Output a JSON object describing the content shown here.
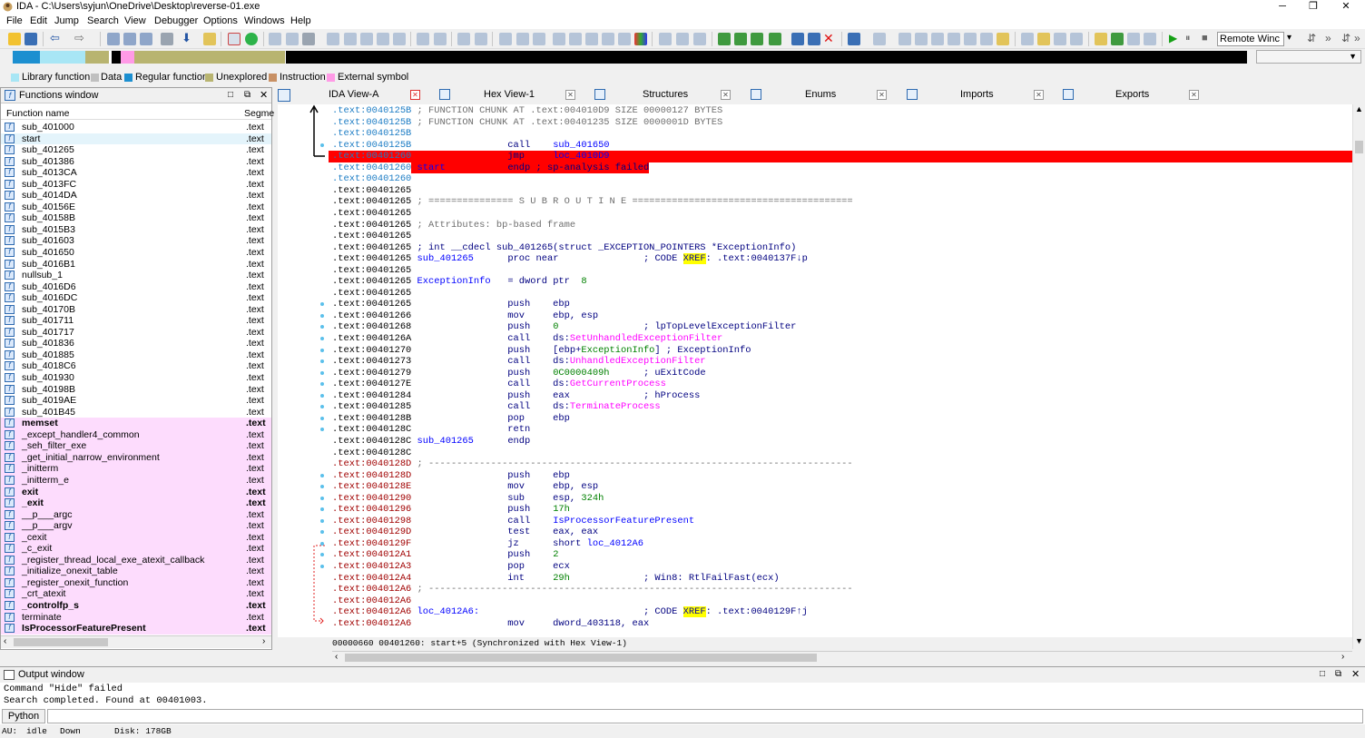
{
  "window": {
    "title": "IDA - C:\\Users\\syjun\\OneDrive\\Desktop\\reverse-01.exe",
    "minimize": "─",
    "maximize": "❐",
    "close": "✕"
  },
  "menu": [
    "File",
    "Edit",
    "Jump",
    "Search",
    "View",
    "Debugger",
    "Options",
    "Windows",
    "Help"
  ],
  "toolbar": {
    "remote_debugger": "Remote Winc"
  },
  "legend": [
    {
      "label": "Library function",
      "color": "#a8e6f5"
    },
    {
      "label": "Data",
      "color": "#c0c0c0"
    },
    {
      "label": "Regular function",
      "color": "#1c8fd0"
    },
    {
      "label": "Unexplored",
      "color": "#b8b470"
    },
    {
      "label": "Instruction",
      "color": "#c89064"
    },
    {
      "label": "External symbol",
      "color": "#ff9ae6"
    }
  ],
  "functions_window": {
    "title": "Functions window",
    "col_name": "Function name",
    "col_segment": "Segme",
    "items": [
      {
        "name": "sub_401000",
        "seg": ".text",
        "type": "normal"
      },
      {
        "name": "start",
        "seg": ".text",
        "type": "selected"
      },
      {
        "name": "sub_401265",
        "seg": ".text",
        "type": "normal"
      },
      {
        "name": "sub_401386",
        "seg": ".text",
        "type": "normal"
      },
      {
        "name": "sub_4013CA",
        "seg": ".text",
        "type": "normal"
      },
      {
        "name": "sub_4013FC",
        "seg": ".text",
        "type": "normal"
      },
      {
        "name": "sub_4014DA",
        "seg": ".text",
        "type": "normal"
      },
      {
        "name": "sub_40156E",
        "seg": ".text",
        "type": "normal"
      },
      {
        "name": "sub_40158B",
        "seg": ".text",
        "type": "normal"
      },
      {
        "name": "sub_4015B3",
        "seg": ".text",
        "type": "normal"
      },
      {
        "name": "sub_401603",
        "seg": ".text",
        "type": "normal"
      },
      {
        "name": "sub_401650",
        "seg": ".text",
        "type": "normal"
      },
      {
        "name": "sub_4016B1",
        "seg": ".text",
        "type": "normal"
      },
      {
        "name": "nullsub_1",
        "seg": ".text",
        "type": "normal"
      },
      {
        "name": "sub_4016D6",
        "seg": ".text",
        "type": "normal"
      },
      {
        "name": "sub_4016DC",
        "seg": ".text",
        "type": "normal"
      },
      {
        "name": "sub_40170B",
        "seg": ".text",
        "type": "normal"
      },
      {
        "name": "sub_401711",
        "seg": ".text",
        "type": "normal"
      },
      {
        "name": "sub_401717",
        "seg": ".text",
        "type": "normal"
      },
      {
        "name": "sub_401836",
        "seg": ".text",
        "type": "normal"
      },
      {
        "name": "sub_401885",
        "seg": ".text",
        "type": "normal"
      },
      {
        "name": "sub_4018C6",
        "seg": ".text",
        "type": "normal"
      },
      {
        "name": "sub_401930",
        "seg": ".text",
        "type": "normal"
      },
      {
        "name": "sub_40198B",
        "seg": ".text",
        "type": "normal"
      },
      {
        "name": "sub_4019AE",
        "seg": ".text",
        "type": "normal"
      },
      {
        "name": "sub_401B45",
        "seg": ".text",
        "type": "normal"
      },
      {
        "name": "memset",
        "seg": ".text",
        "type": "lib-bold"
      },
      {
        "name": "_except_handler4_common",
        "seg": ".text",
        "type": "lib"
      },
      {
        "name": "_seh_filter_exe",
        "seg": ".text",
        "type": "lib"
      },
      {
        "name": "_get_initial_narrow_environment",
        "seg": ".text",
        "type": "lib"
      },
      {
        "name": "_initterm",
        "seg": ".text",
        "type": "lib"
      },
      {
        "name": "_initterm_e",
        "seg": ".text",
        "type": "lib"
      },
      {
        "name": "exit",
        "seg": ".text",
        "type": "lib-bold"
      },
      {
        "name": "_exit",
        "seg": ".text",
        "type": "lib-bold"
      },
      {
        "name": "__p___argc",
        "seg": ".text",
        "type": "lib"
      },
      {
        "name": "__p___argv",
        "seg": ".text",
        "type": "lib"
      },
      {
        "name": "_cexit",
        "seg": ".text",
        "type": "lib"
      },
      {
        "name": "_c_exit",
        "seg": ".text",
        "type": "lib"
      },
      {
        "name": "_register_thread_local_exe_atexit_callback",
        "seg": ".text",
        "type": "lib"
      },
      {
        "name": "_initialize_onexit_table",
        "seg": ".text",
        "type": "lib"
      },
      {
        "name": "_register_onexit_function",
        "seg": ".text",
        "type": "lib"
      },
      {
        "name": "_crt_atexit",
        "seg": ".text",
        "type": "lib"
      },
      {
        "name": "_controlfp_s",
        "seg": ".text",
        "type": "lib-bold"
      },
      {
        "name": "terminate",
        "seg": ".text",
        "type": "lib"
      },
      {
        "name": "IsProcessorFeaturePresent",
        "seg": ".text",
        "type": "lib-bold"
      }
    ]
  },
  "tabs": [
    {
      "label": "IDA View-A",
      "active": true
    },
    {
      "label": "Hex View-1"
    },
    {
      "label": "Structures"
    },
    {
      "label": "Enums"
    },
    {
      "label": "Imports"
    },
    {
      "label": "Exports"
    }
  ],
  "disasm": [
    {
      "addr": ".text:0040125B",
      "ac": "blue",
      "parts": [
        [
          "c-com",
          " ; FUNCTION CHUNK AT .text:004010D9 SIZE 00000127 BYTES"
        ]
      ]
    },
    {
      "addr": ".text:0040125B",
      "ac": "blue",
      "parts": [
        [
          "c-com",
          " ; FUNCTION CHUNK AT .text:00401235 SIZE 0000001D BYTES"
        ]
      ]
    },
    {
      "addr": ".text:0040125B",
      "ac": "blue",
      "parts": []
    },
    {
      "addr": ".text:0040125B",
      "ac": "blue",
      "parts": [
        [
          "c-ins",
          "                 call    "
        ],
        [
          "c-name",
          "sub_401650"
        ]
      ]
    },
    {
      "addr": ".text:00401260",
      "ac": "hl",
      "parts": [
        [
          "c-ins",
          "                 jmp     "
        ],
        [
          "c-name",
          "loc_4010D9"
        ]
      ]
    },
    {
      "addr": ".text:00401260",
      "ac": "blue",
      "parts": [
        [
          "c-name",
          " start           "
        ],
        [
          "c-ins",
          "endp ; sp-analysis failed"
        ]
      ],
      "hlpart": true
    },
    {
      "addr": ".text:00401260",
      "ac": "blue",
      "parts": []
    },
    {
      "addr": ".text:00401265",
      "ac": "black",
      "parts": []
    },
    {
      "addr": ".text:00401265",
      "ac": "black",
      "parts": [
        [
          "c-com",
          " ; =============== S U B R O U T I N E ======================================="
        ]
      ]
    },
    {
      "addr": ".text:00401265",
      "ac": "black",
      "parts": []
    },
    {
      "addr": ".text:00401265",
      "ac": "black",
      "parts": [
        [
          "c-com",
          " ; Attributes: bp-based frame"
        ]
      ]
    },
    {
      "addr": ".text:00401265",
      "ac": "black",
      "parts": []
    },
    {
      "addr": ".text:00401265",
      "ac": "black",
      "parts": [
        [
          "c-ins",
          " ; int __cdecl sub_401265(struct _EXCEPTION_POINTERS *ExceptionInfo)"
        ]
      ]
    },
    {
      "addr": ".text:00401265",
      "ac": "black",
      "parts": [
        [
          "c-name",
          " sub_401265      "
        ],
        [
          "c-ins",
          "proc near               "
        ],
        [
          "c-ins",
          "; CODE "
        ],
        [
          "xref",
          "XREF"
        ],
        [
          "c-ins",
          ": .text:0040137F↓p"
        ]
      ]
    },
    {
      "addr": ".text:00401265",
      "ac": "black",
      "parts": []
    },
    {
      "addr": ".text:00401265",
      "ac": "black",
      "parts": [
        [
          "c-name",
          " ExceptionInfo   "
        ],
        [
          "c-ins",
          "= dword ptr  "
        ],
        [
          "c-num",
          "8"
        ]
      ]
    },
    {
      "addr": ".text:00401265",
      "ac": "black",
      "parts": []
    },
    {
      "addr": ".text:00401265",
      "ac": "black",
      "parts": [
        [
          "c-ins",
          "                 push    ebp"
        ]
      ]
    },
    {
      "addr": ".text:00401266",
      "ac": "black",
      "parts": [
        [
          "c-ins",
          "                 mov     ebp, esp"
        ]
      ]
    },
    {
      "addr": ".text:00401268",
      "ac": "black",
      "parts": [
        [
          "c-ins",
          "                 push    "
        ],
        [
          "c-num",
          "0"
        ],
        [
          "c-ins",
          "               ; lpTopLevelExceptionFilter"
        ]
      ]
    },
    {
      "addr": ".text:0040126A",
      "ac": "black",
      "parts": [
        [
          "c-ins",
          "                 call    ds:"
        ],
        [
          "c-imp",
          "SetUnhandledExceptionFilter"
        ]
      ]
    },
    {
      "addr": ".text:00401270",
      "ac": "black",
      "parts": [
        [
          "c-ins",
          "                 push    [ebp+"
        ],
        [
          "c-num",
          "ExceptionInfo"
        ],
        [
          "c-ins",
          "] ; ExceptionInfo"
        ]
      ]
    },
    {
      "addr": ".text:00401273",
      "ac": "black",
      "parts": [
        [
          "c-ins",
          "                 call    ds:"
        ],
        [
          "c-imp",
          "UnhandledExceptionFilter"
        ]
      ]
    },
    {
      "addr": ".text:00401279",
      "ac": "black",
      "parts": [
        [
          "c-ins",
          "                 push    "
        ],
        [
          "c-num",
          "0C0000409h"
        ],
        [
          "c-ins",
          "      ; uExitCode"
        ]
      ]
    },
    {
      "addr": ".text:0040127E",
      "ac": "black",
      "parts": [
        [
          "c-ins",
          "                 call    ds:"
        ],
        [
          "c-imp",
          "GetCurrentProcess"
        ]
      ]
    },
    {
      "addr": ".text:00401284",
      "ac": "black",
      "parts": [
        [
          "c-ins",
          "                 push    eax             ; hProcess"
        ]
      ]
    },
    {
      "addr": ".text:00401285",
      "ac": "black",
      "parts": [
        [
          "c-ins",
          "                 call    ds:"
        ],
        [
          "c-imp",
          "TerminateProcess"
        ]
      ]
    },
    {
      "addr": ".text:0040128B",
      "ac": "black",
      "parts": [
        [
          "c-ins",
          "                 pop     ebp"
        ]
      ]
    },
    {
      "addr": ".text:0040128C",
      "ac": "black",
      "parts": [
        [
          "c-ins",
          "                 retn"
        ]
      ]
    },
    {
      "addr": ".text:0040128C",
      "ac": "black",
      "parts": [
        [
          "c-name",
          " sub_401265      "
        ],
        [
          "c-ins",
          "endp"
        ]
      ]
    },
    {
      "addr": ".text:0040128C",
      "ac": "black",
      "parts": []
    },
    {
      "addr": ".text:0040128D",
      "ac": "red",
      "parts": [
        [
          "c-com",
          " ; ---------------------------------------------------------------------------"
        ]
      ]
    },
    {
      "addr": ".text:0040128D",
      "ac": "red",
      "parts": [
        [
          "c-ins",
          "                 push    ebp"
        ]
      ]
    },
    {
      "addr": ".text:0040128E",
      "ac": "red",
      "parts": [
        [
          "c-ins",
          "                 mov     ebp, esp"
        ]
      ]
    },
    {
      "addr": ".text:00401290",
      "ac": "red",
      "parts": [
        [
          "c-ins",
          "                 sub     esp, "
        ],
        [
          "c-num",
          "324h"
        ]
      ]
    },
    {
      "addr": ".text:00401296",
      "ac": "red",
      "parts": [
        [
          "c-ins",
          "                 push    "
        ],
        [
          "c-num",
          "17h"
        ]
      ]
    },
    {
      "addr": ".text:00401298",
      "ac": "red",
      "parts": [
        [
          "c-ins",
          "                 call    "
        ],
        [
          "c-name",
          "IsProcessorFeaturePresent"
        ]
      ]
    },
    {
      "addr": ".text:0040129D",
      "ac": "red",
      "parts": [
        [
          "c-ins",
          "                 test    eax, eax"
        ]
      ]
    },
    {
      "addr": ".text:0040129F",
      "ac": "red",
      "parts": [
        [
          "c-ins",
          "                 jz      short "
        ],
        [
          "c-name",
          "loc_4012A6"
        ]
      ]
    },
    {
      "addr": ".text:004012A1",
      "ac": "red",
      "parts": [
        [
          "c-ins",
          "                 push    "
        ],
        [
          "c-num",
          "2"
        ]
      ]
    },
    {
      "addr": ".text:004012A3",
      "ac": "red",
      "parts": [
        [
          "c-ins",
          "                 pop     ecx"
        ]
      ]
    },
    {
      "addr": ".text:004012A4",
      "ac": "red",
      "parts": [
        [
          "c-ins",
          "                 int     "
        ],
        [
          "c-num",
          "29h"
        ],
        [
          "c-ins",
          "             ; Win8: RtlFailFast(ecx)"
        ]
      ]
    },
    {
      "addr": ".text:004012A6",
      "ac": "red",
      "parts": [
        [
          "c-com",
          " ; ---------------------------------------------------------------------------"
        ]
      ]
    },
    {
      "addr": ".text:004012A6",
      "ac": "red",
      "parts": []
    },
    {
      "addr": ".text:004012A6",
      "ac": "red",
      "parts": [
        [
          "c-name",
          " loc_4012A6:"
        ],
        [
          "c-ins",
          "                             ; CODE "
        ],
        [
          "xref",
          "XREF"
        ],
        [
          "c-ins",
          ": .text:0040129F↑j"
        ]
      ]
    },
    {
      "addr": ".text:004012A6",
      "ac": "red",
      "parts": [
        [
          "c-ins",
          "                 mov     dword_403118, eax"
        ]
      ]
    }
  ],
  "view_status": "00000660 00401260: start+5 (Synchronized with Hex View-1)",
  "output_window": {
    "title": "Output window",
    "lines": [
      "Command \"Hide\" failed",
      "Search completed. Found at 00401003."
    ],
    "python_label": "Python"
  },
  "statusbar": {
    "au": "AU:",
    "state": "idle",
    "dir": "Down",
    "disk": "Disk: 178GB"
  }
}
